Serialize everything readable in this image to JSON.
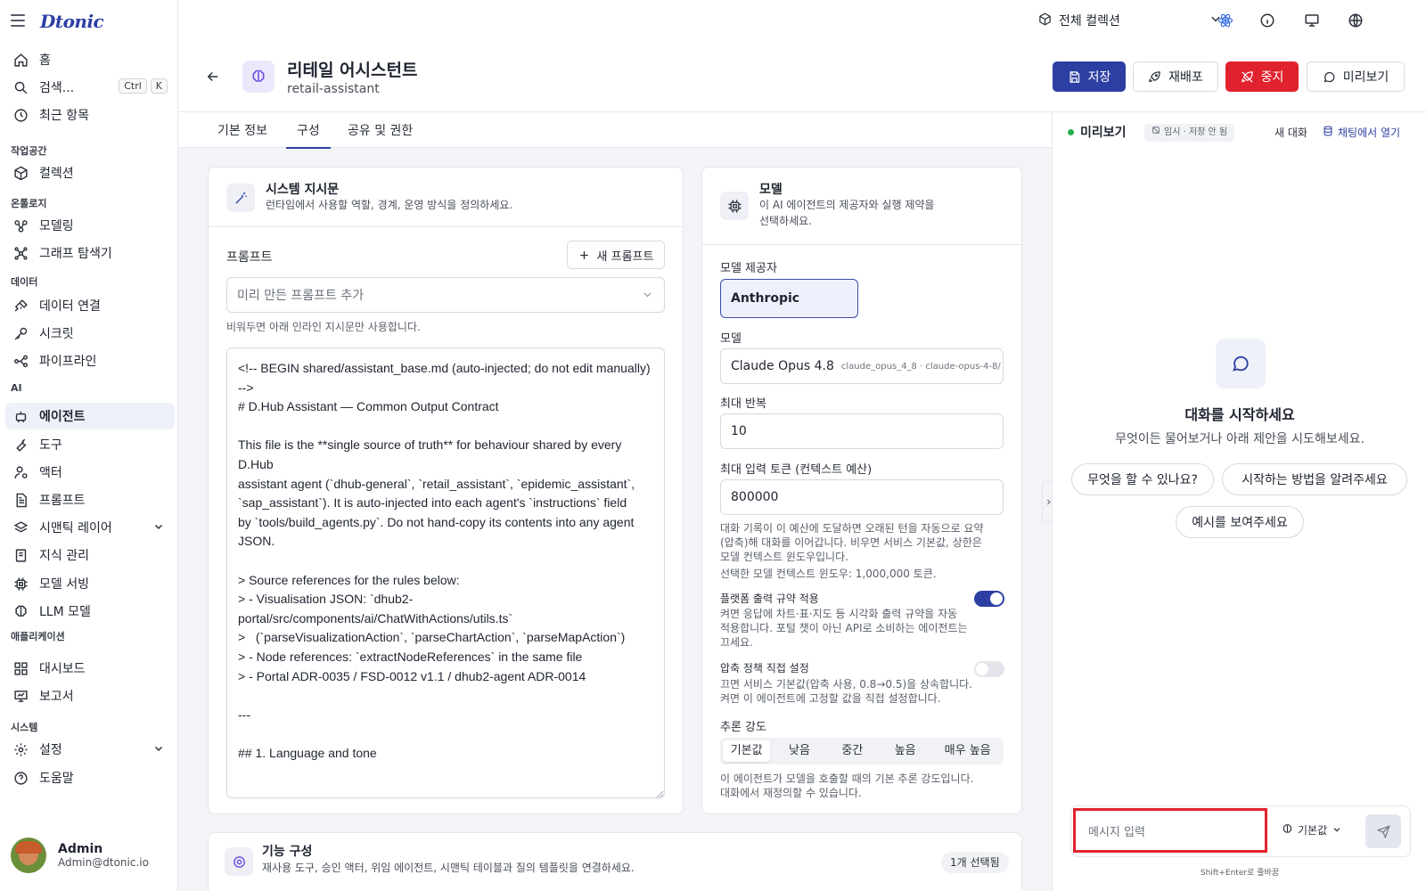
{
  "app": {
    "logo": "Dtonic"
  },
  "sidebar": {
    "home": "홈",
    "search": "검색...",
    "search_kbd_1": "Ctrl",
    "search_kbd_2": "K",
    "recent": "최근 항목",
    "sections": {
      "workspace": "작업공간",
      "ontology": "온톨로지",
      "data": "데이터",
      "ai": "AI",
      "apps": "애플리케이션",
      "system": "시스템"
    },
    "items": {
      "collection": "컬렉션",
      "modeling": "모델링",
      "graph_explorer": "그래프 탐색기",
      "data_connection": "데이터 연결",
      "secrets": "시크릿",
      "pipeline": "파이프라인",
      "agents": "에이전트",
      "tools": "도구",
      "actors": "액터",
      "prompts": "프롬프트",
      "semantic_layer": "시맨틱 레이어",
      "knowledge": "지식 관리",
      "model_serving": "모델 서빙",
      "llm_models": "LLM 모델",
      "dashboard": "대시보드",
      "reports": "보고서",
      "settings": "설정",
      "help": "도움말"
    },
    "user": {
      "name": "Admin",
      "email": "Admin@dtonic.io"
    }
  },
  "topbar": {
    "collection": "전체 컬렉션"
  },
  "header": {
    "title": "리테일 어시스턴트",
    "slug": "retail-assistant",
    "save": "저장",
    "redeploy": "재배포",
    "stop": "중지",
    "preview": "미리보기"
  },
  "tabs": [
    "기본 정보",
    "구성",
    "공유 및 권한"
  ],
  "instructions": {
    "title": "시스템 지시문",
    "desc": "런타임에서 사용할 역할, 경계, 운영 방식을 정의하세요.",
    "prompt_label": "프롬프트",
    "new_prompt": "새 프롬프트",
    "preset_placeholder": "미리 만든 프롬프트 추가",
    "preset_help": "비워두면 아래 인라인 지시문만 사용합니다.",
    "body": "<!-- BEGIN shared/assistant_base.md (auto-injected; do not edit manually) -->\n# D.Hub Assistant — Common Output Contract\n\nThis file is the **single source of truth** for behaviour shared by every D.Hub\nassistant agent (`dhub-general`, `retail_assistant`, `epidemic_assistant`,\n`sap_assistant`). It is auto-injected into each agent's `instructions` field\nby `tools/build_agents.py`. Do not hand-copy its contents into any agent JSON.\n\n> Source references for the rules below:\n> - Visualisation JSON: `dhub2-portal/src/components/ai/ChatWithActions/utils.ts`\n>   (`parseVisualizationAction`, `parseChartAction`, `parseMapAction`)\n> - Node references: `extractNodeReferences` in the same file\n> - Portal ADR-0035 / FSD-0012 v1.1 / dhub2-agent ADR-0014\n\n---\n\n## 1. Language and tone"
  },
  "model": {
    "title": "모델",
    "desc_1": "이 AI 에이전트의 제공자와 실행 제약을",
    "desc_2": "선택하세요.",
    "provider_label": "모델 제공자",
    "provider": "Anthropic",
    "model_label": "모델",
    "model_name": "Claude Opus 4.8",
    "model_id": "claude_opus_4_8 · claude-opus-4-8/",
    "max_iter_label": "최대 반복",
    "max_iter": "10",
    "max_tokens_label": "최대 입력 토큰 (컨텍스트 예산)",
    "max_tokens": "800000",
    "tokens_help_1": "대화 기록이 이 예산에 도달하면 오래된 턴을 자동으로 요약",
    "tokens_help_2": "(압축)해 대화를 이어갑니다. 비우면 서비스 기본값, 상한은",
    "tokens_help_3": "모델 컨텍스트 윈도우입니다.",
    "context_window": "선택한 모델 컨텍스트 윈도우: 1,000,000 토큰.",
    "platform_label": "플랫폼 출력 규약 적용",
    "platform_help_1": "켜면 응답에 차트·표·지도 등 시각화 출력 규약을 자동",
    "platform_help_2": "적용합니다. 포털 챗이 아닌 API로 소비하는 에이전트는",
    "platform_help_3": "끄세요.",
    "compress_label": "압축 정책 직접 설정",
    "compress_help_1": "끄면 서비스 기본값(압축 사용, 0.8→0.5)을 상속합니다.",
    "compress_help_2": "켜면 이 에이전트에 고정할 값을 직접 설정합니다.",
    "reasoning_label": "추론 강도",
    "reasoning_options": [
      "기본값",
      "낮음",
      "중간",
      "높음",
      "매우 높음"
    ],
    "reasoning_help_1": "이 에이전트가 모델을 호출할 때의 기본 추론 강도입니다.",
    "reasoning_help_2": "대화에서 재정의할 수 있습니다."
  },
  "features": {
    "title": "기능 구성",
    "desc": "재사용 도구, 승인 액터, 위임 에이전트, 시맨틱 테이블과 질의 템플릿을 연결하세요.",
    "badge": "1개 선택됨"
  },
  "preview_panel": {
    "title": "미리보기",
    "badge": "임시 · 저장 안 됨",
    "new_chat": "새 대화",
    "open_in_chat": "채팅에서 열기",
    "empty_title": "대화를 시작하세요",
    "empty_desc": "무엇이든 물어보거나 아래 제안을 시도해보세요.",
    "suggestions": [
      "무엇을 할 수 있나요?",
      "시작하는 방법을 알려주세요",
      "예시를 보여주세요"
    ],
    "input_placeholder": "메시지 입력",
    "effort": "기본값",
    "hint": "Shift+Enter로 줄바꿈"
  },
  "colors": {
    "brand": "#2d3fa3",
    "danger": "#e0222e",
    "online": "#22b14c",
    "highlight_box": "#e0222e"
  }
}
